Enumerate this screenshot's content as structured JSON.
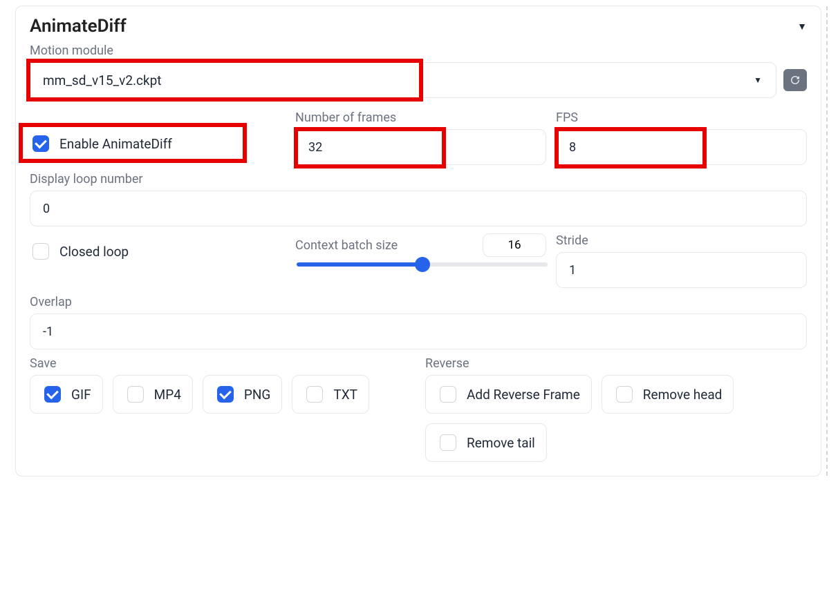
{
  "panel": {
    "title": "AnimateDiff",
    "motion_module_label": "Motion module",
    "motion_module_value": "mm_sd_v15_v2.ckpt",
    "enable_label": "Enable AnimateDiff",
    "enable_checked": true,
    "frames_label": "Number of frames",
    "frames_value": "32",
    "fps_label": "FPS",
    "fps_value": "8",
    "display_loop_label": "Display loop number",
    "display_loop_value": "0",
    "closed_loop_label": "Closed loop",
    "closed_loop_checked": false,
    "context_label": "Context batch size",
    "context_value": "16",
    "context_slider": 16,
    "context_min": 0,
    "context_max": 32,
    "stride_label": "Stride",
    "stride_value": "1",
    "overlap_label": "Overlap",
    "overlap_value": "-1",
    "save_label": "Save",
    "save_options": [
      {
        "label": "GIF",
        "checked": true
      },
      {
        "label": "MP4",
        "checked": false
      },
      {
        "label": "PNG",
        "checked": true
      },
      {
        "label": "TXT",
        "checked": false
      }
    ],
    "reverse_label": "Reverse",
    "reverse_options": [
      {
        "label": "Add Reverse Frame",
        "checked": false
      },
      {
        "label": "Remove head",
        "checked": false
      },
      {
        "label": "Remove tail",
        "checked": false
      }
    ]
  }
}
